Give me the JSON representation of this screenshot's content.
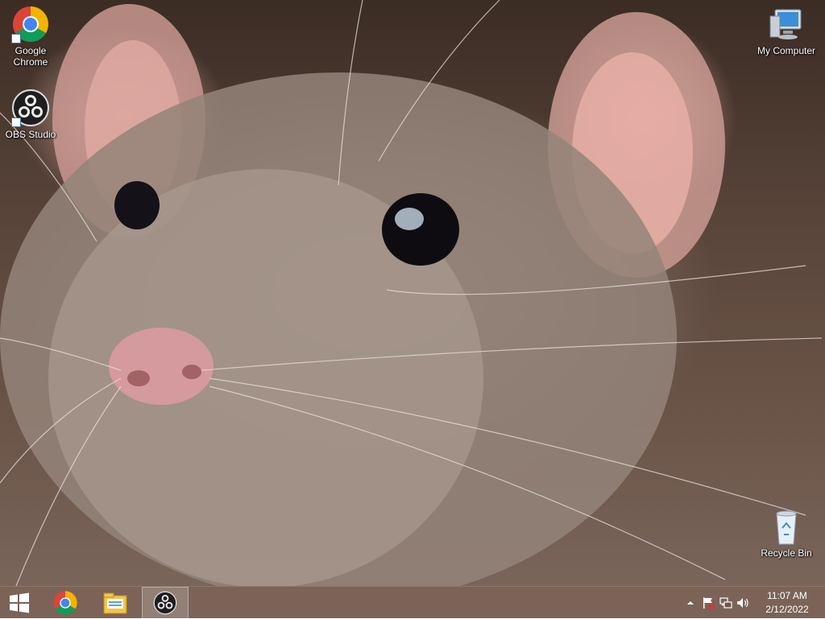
{
  "desktop": {
    "icons": [
      {
        "label": "Google\nChrome",
        "icon": "chrome-icon"
      },
      {
        "label": "OBS Studio",
        "icon": "obs-icon"
      },
      {
        "label": "My Computer",
        "icon": "computer-icon"
      },
      {
        "label": "Recycle Bin",
        "icon": "recycle-bin-icon"
      }
    ]
  },
  "taskbar": {
    "start_icon": "windows-start-icon",
    "pinned": [
      {
        "icon": "chrome-icon"
      },
      {
        "icon": "file-explorer-icon"
      },
      {
        "icon": "obs-icon",
        "active": true
      }
    ],
    "tray": {
      "show_hidden_icon": "chevron-up-icon",
      "action_center_icon": "flag-icon",
      "network_icon": "network-icon",
      "volume_icon": "speaker-icon"
    },
    "clock": {
      "time": "11:07 AM",
      "date": "2/12/2022"
    }
  },
  "colors": {
    "taskbar_bg": "#70564a",
    "icon_text": "#ffffff"
  }
}
